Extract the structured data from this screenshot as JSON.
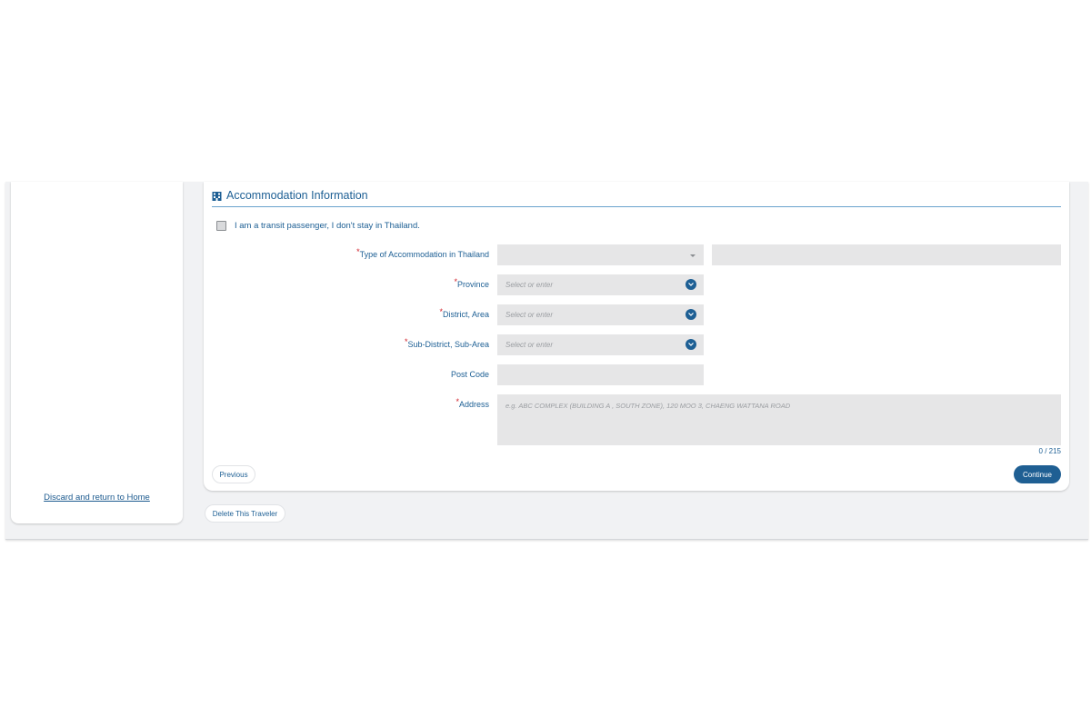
{
  "sidebar": {
    "discard_link": "Discard and return to Home"
  },
  "section": {
    "title": "Accommodation Information",
    "icon": "building-icon"
  },
  "transit": {
    "label": "I am a transit passenger, I don't stay in Thailand.",
    "checked": false
  },
  "form": {
    "accommodation_type": {
      "label": "Type of Accommodation in Thailand",
      "required": "*",
      "value": ""
    },
    "province": {
      "label": "Province",
      "required": "*",
      "placeholder": "Select or enter"
    },
    "district": {
      "label": "District, Area",
      "required": "*",
      "placeholder": "Select or enter"
    },
    "subdistrict": {
      "label": "Sub-District, Sub-Area",
      "required": "*",
      "placeholder": "Select or enter"
    },
    "postcode": {
      "label": "Post Code",
      "value": ""
    },
    "address": {
      "label": "Address",
      "required": "*",
      "placeholder": "e.g. ABC COMPLEX (BUILDING A , SOUTH ZONE), 120 MOO 3, CHAENG WATTANA ROAD",
      "counter": "0 / 215"
    }
  },
  "buttons": {
    "previous": "Previous",
    "continue": "Continue",
    "delete_traveler": "Delete This Traveler"
  },
  "colors": {
    "accent": "#1d5f94",
    "required": "#d0202a",
    "field_bg": "#e6e6e7"
  }
}
